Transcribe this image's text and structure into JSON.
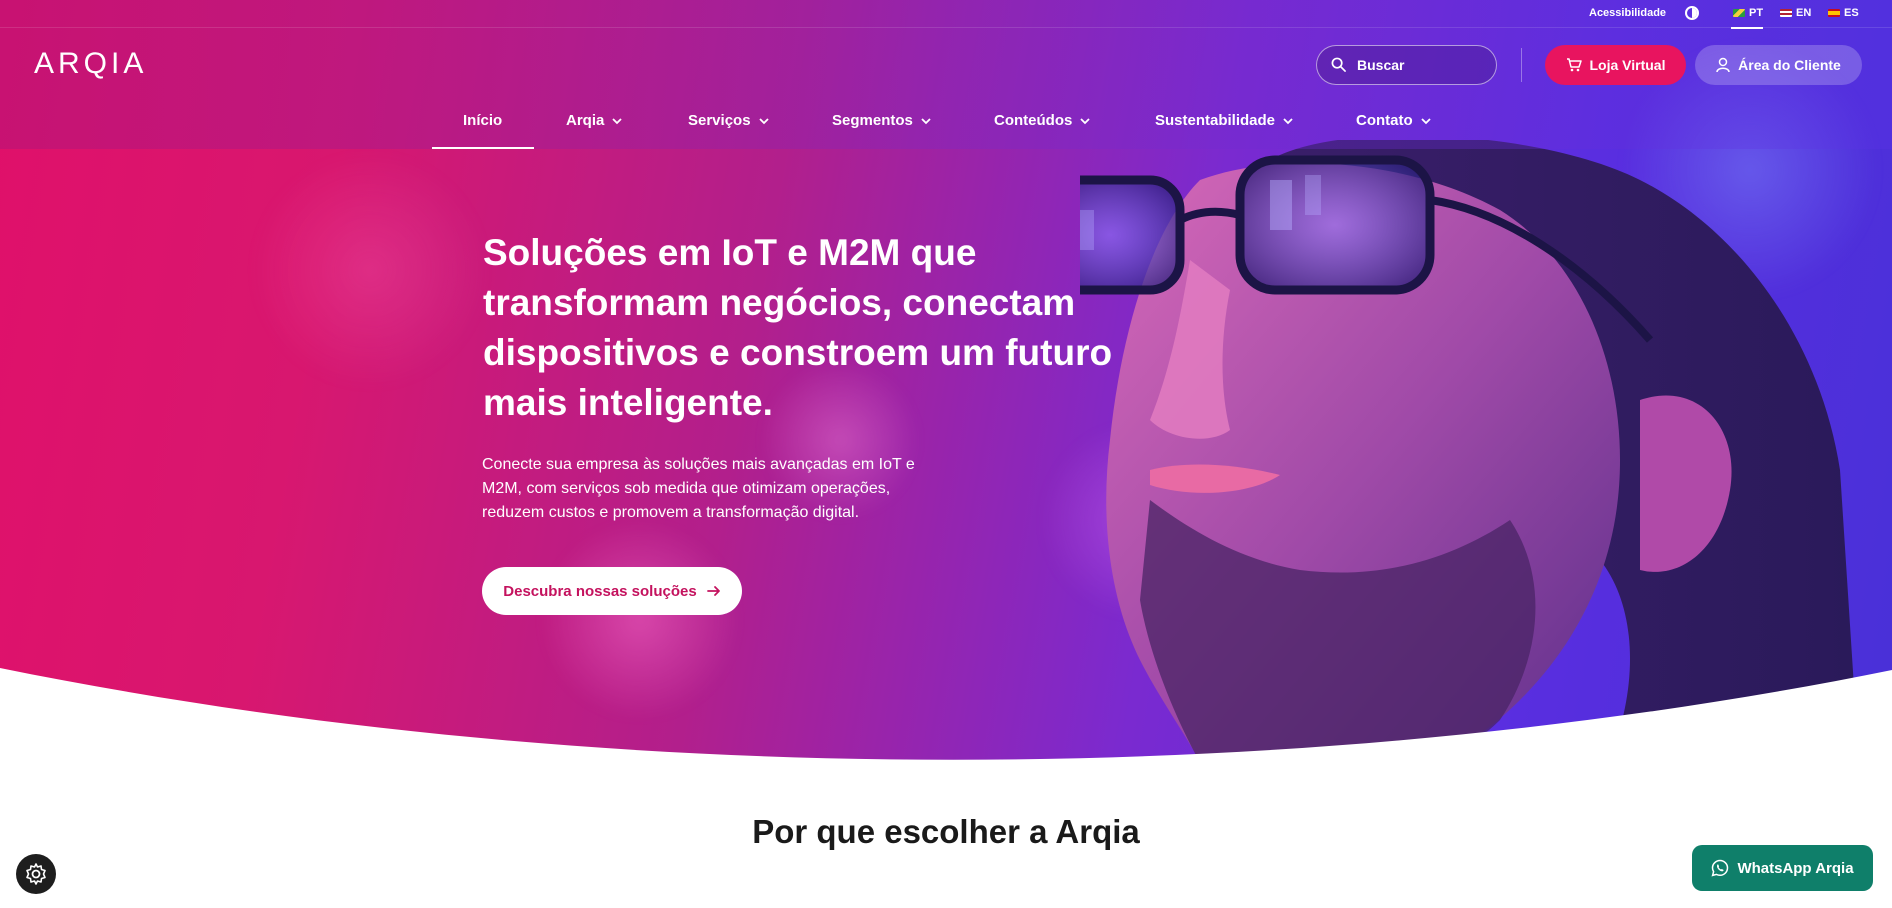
{
  "topbar": {
    "accessibility_label": "Acessibilidade",
    "languages": [
      {
        "code": "PT",
        "flag_colors": [
          "#2a9d3f",
          "#f4d03f"
        ],
        "active": true
      },
      {
        "code": "EN",
        "flag_colors": [
          "#b22234",
          "#3c3b6e"
        ],
        "active": false
      },
      {
        "code": "ES",
        "flag_colors": [
          "#c60b1e",
          "#ffc400"
        ],
        "active": false
      }
    ]
  },
  "header": {
    "logo_text": "ARQIA",
    "search_placeholder": "Buscar",
    "store_button": "Loja Virtual",
    "client_button": "Área do Cliente"
  },
  "nav": {
    "items": [
      {
        "label": "Início",
        "has_dropdown": false,
        "active": true
      },
      {
        "label": "Arqia",
        "has_dropdown": true
      },
      {
        "label": "Serviços",
        "has_dropdown": true
      },
      {
        "label": "Segmentos",
        "has_dropdown": true
      },
      {
        "label": "Conteúdos",
        "has_dropdown": true
      },
      {
        "label": "Sustentabilidade",
        "has_dropdown": true
      },
      {
        "label": "Contato",
        "has_dropdown": true
      }
    ]
  },
  "hero": {
    "title": "Soluções em IoT e M2M que transformam negócios, conectam dispositivos e constroem um futuro mais inteligente.",
    "subtitle": "Conecte sua empresa às soluções mais avançadas em IoT e M2M, com serviços sob medida que otimizam operações, reduzem custos e promovem a transformação digital.",
    "cta_label": "Descubra nossas soluções"
  },
  "section": {
    "title": "Por que escolher a Arqia"
  },
  "floating": {
    "whatsapp_label": "WhatsApp Arqia"
  },
  "colors": {
    "brand_pink": "#e8145f",
    "whatsapp_green": "#0f7f6a",
    "hero_start": "#e0106a",
    "hero_end": "#4930d8"
  }
}
